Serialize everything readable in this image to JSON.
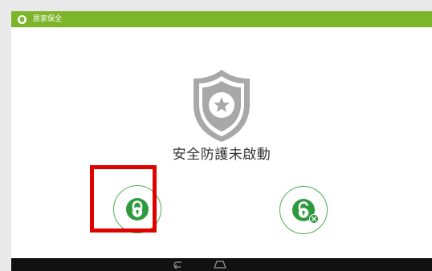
{
  "app": {
    "title": "居家保全",
    "status_text": "安全防護未啟動"
  },
  "icons": {
    "title_icon": "shield-icon",
    "main_graphic": "shield-star-icon",
    "lock_button": "lock-icon",
    "unlock_button": "unlock-cancel-icon",
    "nav_back": "back-icon",
    "nav_home": "home-icon"
  },
  "colors": {
    "accent": "#7cb52a",
    "button_green": "#2e9a3e",
    "shield_gray": "#a8a8a8",
    "highlight": "#e00000"
  }
}
